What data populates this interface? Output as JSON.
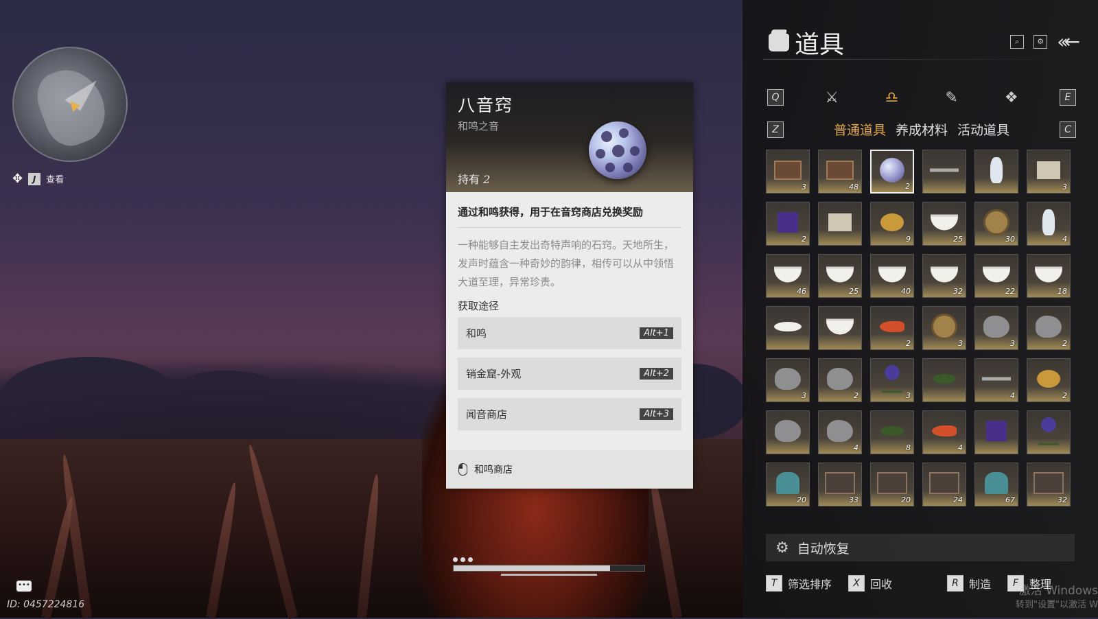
{
  "hud": {
    "view_key": "J",
    "view_label": "查看",
    "player_id": "ID: 0457224816",
    "progress": 0.82
  },
  "detail": {
    "name": "八音窍",
    "subtitle": "和鸣之音",
    "own_label": "持有",
    "own_count": "2",
    "summary": "通过和鸣获得，用于在音窍商店兑换奖励",
    "description": "一种能够自主发出奇特声响的石窍。天地所生，发声时蕴含一种奇妙的韵律，相传可以从中领悟大道至理，异常珍贵。",
    "sources_title": "获取途径",
    "sources": [
      {
        "label": "和鸣",
        "key": "Alt+1"
      },
      {
        "label": "销金窟-外观",
        "key": "Alt+2"
      },
      {
        "label": "闻音商店",
        "key": "Alt+3"
      }
    ],
    "footer_label": "和鸣商店"
  },
  "inventory": {
    "title": "道具",
    "cat_left_key": "Q",
    "cat_right_key": "E",
    "sub_left_key": "Z",
    "sub_right_key": "C",
    "categories": [
      "crossed-swords-icon",
      "pouch-icon",
      "scroll-icon",
      "badge-icon"
    ],
    "active_category": 1,
    "subtabs": [
      "普通道具",
      "养成材料",
      "活动道具"
    ],
    "active_subtab": 0,
    "items": [
      {
        "icon": "box",
        "count": "3"
      },
      {
        "icon": "box",
        "count": "48"
      },
      {
        "icon": "orb",
        "count": "2",
        "selected": true
      },
      {
        "icon": "stick",
        "count": ""
      },
      {
        "icon": "vase",
        "count": ""
      },
      {
        "icon": "book",
        "count": "3"
      },
      {
        "icon": "gem",
        "count": "2"
      },
      {
        "icon": "book",
        "count": ""
      },
      {
        "icon": "frog",
        "count": "9"
      },
      {
        "icon": "bowl",
        "count": "25"
      },
      {
        "icon": "coin",
        "count": "30"
      },
      {
        "icon": "vase",
        "count": "4"
      },
      {
        "icon": "bowl",
        "count": "46"
      },
      {
        "icon": "bowl",
        "count": "25"
      },
      {
        "icon": "bowl",
        "count": "40"
      },
      {
        "icon": "bowl",
        "count": "32"
      },
      {
        "icon": "bowl",
        "count": "22"
      },
      {
        "icon": "bowl",
        "count": "18"
      },
      {
        "icon": "plate",
        "count": ""
      },
      {
        "icon": "bowl",
        "count": ""
      },
      {
        "icon": "fish",
        "count": "2"
      },
      {
        "icon": "coin",
        "count": "3"
      },
      {
        "icon": "rock",
        "count": "3"
      },
      {
        "icon": "rock",
        "count": "2"
      },
      {
        "icon": "rock",
        "count": "3"
      },
      {
        "icon": "rock",
        "count": "2"
      },
      {
        "icon": "plant",
        "count": "3"
      },
      {
        "icon": "bug",
        "count": ""
      },
      {
        "icon": "stick",
        "count": "4"
      },
      {
        "icon": "frog",
        "count": "2"
      },
      {
        "icon": "rock",
        "count": ""
      },
      {
        "icon": "rock",
        "count": "4"
      },
      {
        "icon": "bug",
        "count": "8"
      },
      {
        "icon": "fish",
        "count": "4"
      },
      {
        "icon": "gem",
        "count": ""
      },
      {
        "icon": "plant",
        "count": ""
      },
      {
        "icon": "bag",
        "count": "20"
      },
      {
        "icon": "chest",
        "count": "33"
      },
      {
        "icon": "chest",
        "count": "20"
      },
      {
        "icon": "chest",
        "count": "24"
      },
      {
        "icon": "bag",
        "count": "67"
      },
      {
        "icon": "chest",
        "count": "32"
      }
    ],
    "auto_restore": "自动恢复",
    "actions": [
      {
        "key": "T",
        "label": "筛选排序"
      },
      {
        "key": "X",
        "label": "回收"
      },
      {
        "key": "R",
        "label": "制造"
      },
      {
        "key": "F",
        "label": "整理"
      }
    ],
    "watermark_1": "激活 Windows",
    "watermark_2": "转到\"设置\"以激活 W"
  }
}
